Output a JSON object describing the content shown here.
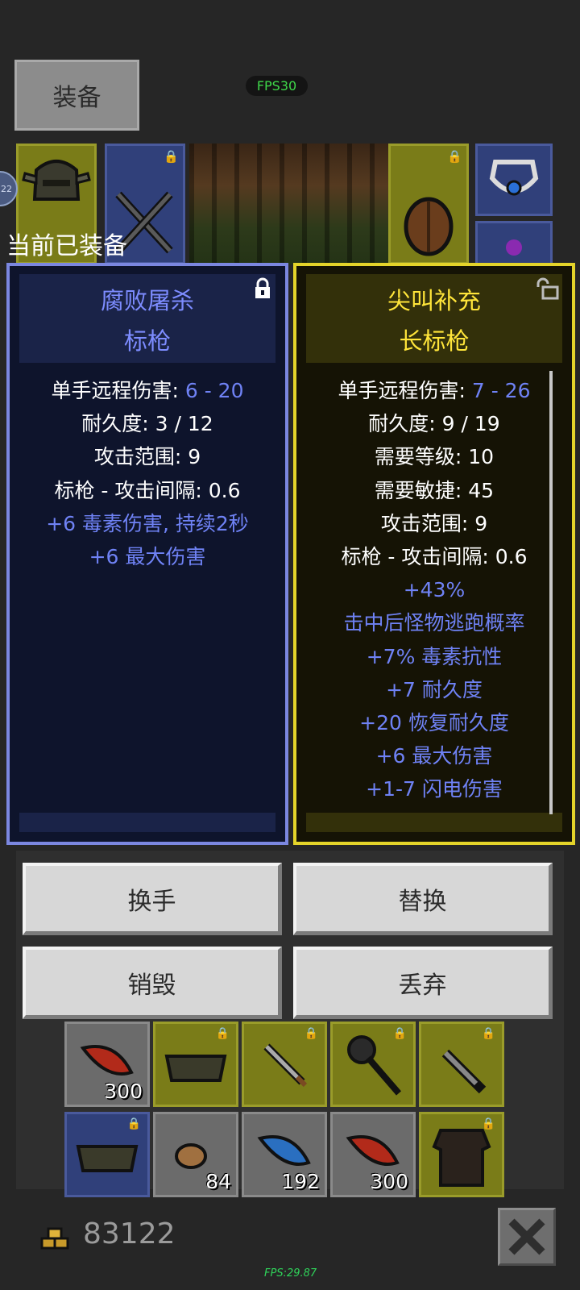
{
  "top_tab": {
    "label": "装备"
  },
  "fps_badge": "FPS30",
  "equipped_label": "当前已装备",
  "left_panel": {
    "name": "腐败屠杀",
    "type": "标枪",
    "locked": true,
    "stats": [
      {
        "label": "单手远程伤害: ",
        "value": "6 - 20"
      },
      {
        "label": "耐久度: 3 / 12",
        "value": ""
      },
      {
        "label": "攻击范围: 9",
        "value": ""
      },
      {
        "label": "标枪 - 攻击间隔: 0.6",
        "value": ""
      }
    ],
    "mods": [
      "+6 毒素伤害, 持续2秒",
      "+6 最大伤害"
    ],
    "accent": "#7d8cff"
  },
  "right_panel": {
    "name": "尖叫补充",
    "type": "长标枪",
    "locked": false,
    "stats": [
      {
        "label": "单手远程伤害: ",
        "value": "7 - 26"
      },
      {
        "label": "耐久度: 9 / 19",
        "value": ""
      },
      {
        "label": "需要等级: 10",
        "value": ""
      },
      {
        "label": "需要敏捷: 45",
        "value": ""
      },
      {
        "label": "攻击范围: 9",
        "value": ""
      },
      {
        "label": "标枪 - 攻击间隔: 0.6",
        "value": ""
      }
    ],
    "mods": [
      "+43%",
      "击中后怪物逃跑概率",
      "+7% 毒素抗性",
      "+7 耐久度",
      "+20 恢复耐久度",
      "+6 最大伤害",
      "+1-7 闪电伤害"
    ],
    "accent": "#ffe53a"
  },
  "actions": {
    "swap_hand": "换手",
    "replace": "替换",
    "destroy": "销毁",
    "discard": "丢弃"
  },
  "inventory": {
    "row1": [
      {
        "icon": "red-leaf-icon",
        "count": "300",
        "rarity": "grey",
        "locked": false
      },
      {
        "icon": "armor-icon",
        "count": "",
        "rarity": "yellow",
        "locked": true
      },
      {
        "icon": "dagger-icon",
        "count": "",
        "rarity": "yellow",
        "locked": true
      },
      {
        "icon": "mace-icon",
        "count": "",
        "rarity": "yellow",
        "locked": true
      },
      {
        "icon": "blade-icon",
        "count": "",
        "rarity": "yellow",
        "locked": true
      }
    ],
    "row2": [
      {
        "icon": "armor-icon",
        "count": "",
        "rarity": "blue",
        "locked": true
      },
      {
        "icon": "nut-icon",
        "count": "84",
        "rarity": "grey",
        "locked": false
      },
      {
        "icon": "blue-leaf-icon",
        "count": "192",
        "rarity": "grey",
        "locked": false
      },
      {
        "icon": "red-leaf-icon",
        "count": "300",
        "rarity": "grey",
        "locked": false
      },
      {
        "icon": "chest-armor-icon",
        "count": "",
        "rarity": "yellow",
        "locked": true
      }
    ]
  },
  "gold": "83122",
  "fps_bottom": "FPS:29.87"
}
